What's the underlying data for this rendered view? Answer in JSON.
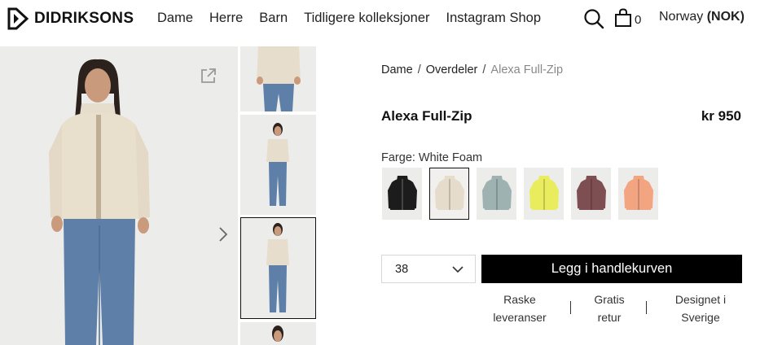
{
  "brand": {
    "name": "DIDRIKSONS"
  },
  "nav": {
    "items": [
      "Dame",
      "Herre",
      "Barn",
      "Tidligere kolleksjoner",
      "Instagram Shop"
    ]
  },
  "header": {
    "cart_count": "0",
    "region": "Norway",
    "currency": "(NOK)"
  },
  "breadcrumb": {
    "items": [
      "Dame",
      "Overdeler"
    ],
    "current": "Alexa Full-Zip",
    "separator": "/"
  },
  "product": {
    "title": "Alexa Full-Zip",
    "price": "kr 950",
    "color_label": "Farge: White Foam",
    "colors": [
      {
        "name": "Black",
        "hex": "#1c1c1c"
      },
      {
        "name": "White Foam",
        "hex": "#e6dccb"
      },
      {
        "name": "Sage",
        "hex": "#9fb2b2"
      },
      {
        "name": "Yellow",
        "hex": "#e9ec5c"
      },
      {
        "name": "Plum",
        "hex": "#7d4e52"
      },
      {
        "name": "Peach",
        "hex": "#f3a582"
      }
    ],
    "selected_color_index": 1,
    "size": "38",
    "add_to_cart_label": "Legg i handlekurven"
  },
  "usps": [
    {
      "line1": "Raske",
      "line2": "leveranser"
    },
    {
      "line1": "Gratis",
      "line2": "retur"
    },
    {
      "line1": "Designet i",
      "line2": "Sverige"
    }
  ],
  "icons": {
    "logo": "didriksons-logo-icon",
    "search": "search-icon",
    "cart": "bag-icon",
    "expand": "external-link-icon",
    "next": "chevron-right-icon",
    "size_dropdown": "chevron-down-icon"
  }
}
